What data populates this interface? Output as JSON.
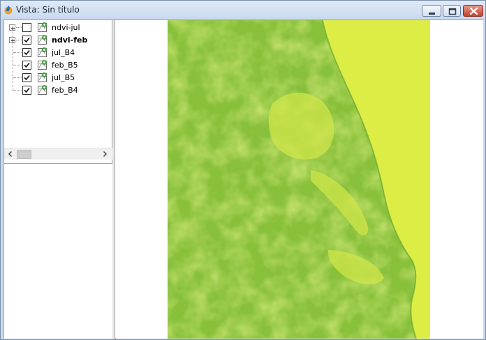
{
  "window": {
    "title": "Vista: Sin título",
    "buttons": {
      "minimize": "minimize-icon",
      "maximize": "restore-icon",
      "close": "close-icon"
    }
  },
  "toc": {
    "layers": [
      {
        "label": "ndvi-jul",
        "checked": false,
        "bold": false,
        "expandable": true
      },
      {
        "label": "ndvi-feb",
        "checked": true,
        "bold": true,
        "expandable": true
      },
      {
        "label": "jul_B4",
        "checked": true,
        "bold": false,
        "expandable": false
      },
      {
        "label": "feb_B5",
        "checked": true,
        "bold": false,
        "expandable": false
      },
      {
        "label": "jul_B5",
        "checked": true,
        "bold": false,
        "expandable": false
      },
      {
        "label": "feb_B4",
        "checked": true,
        "bold": false,
        "expandable": false
      }
    ]
  },
  "colors": {
    "land": "#86c03a",
    "sea": "#dcee46",
    "lagoon": "#cfe64a",
    "titlebar": "#c9d9ee"
  }
}
